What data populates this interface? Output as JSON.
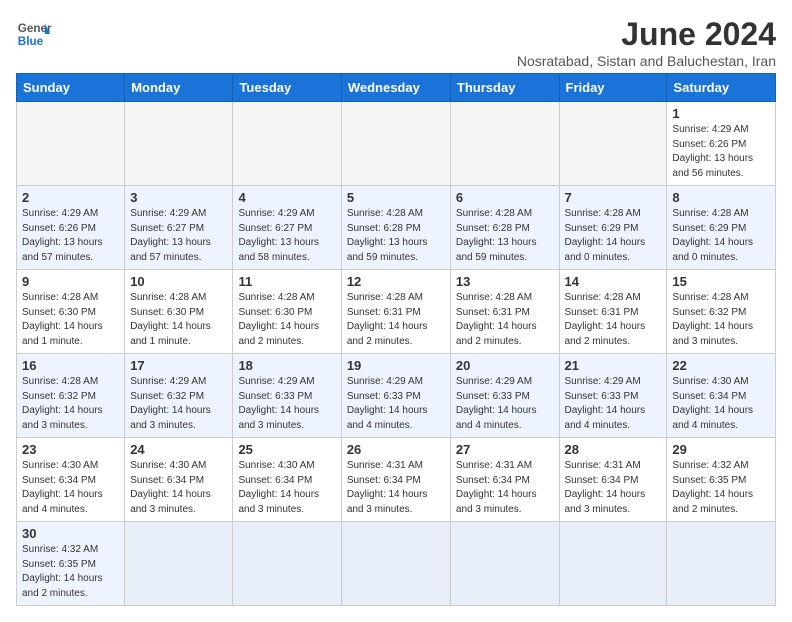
{
  "header": {
    "logo_general": "General",
    "logo_blue": "Blue",
    "month_title": "June 2024",
    "subtitle": "Nosratabad, Sistan and Baluchestan, Iran"
  },
  "weekdays": [
    "Sunday",
    "Monday",
    "Tuesday",
    "Wednesday",
    "Thursday",
    "Friday",
    "Saturday"
  ],
  "weeks": [
    [
      {
        "day": "",
        "info": ""
      },
      {
        "day": "",
        "info": ""
      },
      {
        "day": "",
        "info": ""
      },
      {
        "day": "",
        "info": ""
      },
      {
        "day": "",
        "info": ""
      },
      {
        "day": "",
        "info": ""
      },
      {
        "day": "1",
        "info": "Sunrise: 4:29 AM\nSunset: 6:26 PM\nDaylight: 13 hours\nand 56 minutes."
      }
    ],
    [
      {
        "day": "2",
        "info": "Sunrise: 4:29 AM\nSunset: 6:26 PM\nDaylight: 13 hours\nand 57 minutes."
      },
      {
        "day": "3",
        "info": "Sunrise: 4:29 AM\nSunset: 6:27 PM\nDaylight: 13 hours\nand 57 minutes."
      },
      {
        "day": "4",
        "info": "Sunrise: 4:29 AM\nSunset: 6:27 PM\nDaylight: 13 hours\nand 58 minutes."
      },
      {
        "day": "5",
        "info": "Sunrise: 4:28 AM\nSunset: 6:28 PM\nDaylight: 13 hours\nand 59 minutes."
      },
      {
        "day": "6",
        "info": "Sunrise: 4:28 AM\nSunset: 6:28 PM\nDaylight: 13 hours\nand 59 minutes."
      },
      {
        "day": "7",
        "info": "Sunrise: 4:28 AM\nSunset: 6:29 PM\nDaylight: 14 hours\nand 0 minutes."
      },
      {
        "day": "8",
        "info": "Sunrise: 4:28 AM\nSunset: 6:29 PM\nDaylight: 14 hours\nand 0 minutes."
      }
    ],
    [
      {
        "day": "9",
        "info": "Sunrise: 4:28 AM\nSunset: 6:30 PM\nDaylight: 14 hours\nand 1 minute."
      },
      {
        "day": "10",
        "info": "Sunrise: 4:28 AM\nSunset: 6:30 PM\nDaylight: 14 hours\nand 1 minute."
      },
      {
        "day": "11",
        "info": "Sunrise: 4:28 AM\nSunset: 6:30 PM\nDaylight: 14 hours\nand 2 minutes."
      },
      {
        "day": "12",
        "info": "Sunrise: 4:28 AM\nSunset: 6:31 PM\nDaylight: 14 hours\nand 2 minutes."
      },
      {
        "day": "13",
        "info": "Sunrise: 4:28 AM\nSunset: 6:31 PM\nDaylight: 14 hours\nand 2 minutes."
      },
      {
        "day": "14",
        "info": "Sunrise: 4:28 AM\nSunset: 6:31 PM\nDaylight: 14 hours\nand 2 minutes."
      },
      {
        "day": "15",
        "info": "Sunrise: 4:28 AM\nSunset: 6:32 PM\nDaylight: 14 hours\nand 3 minutes."
      }
    ],
    [
      {
        "day": "16",
        "info": "Sunrise: 4:28 AM\nSunset: 6:32 PM\nDaylight: 14 hours\nand 3 minutes."
      },
      {
        "day": "17",
        "info": "Sunrise: 4:29 AM\nSunset: 6:32 PM\nDaylight: 14 hours\nand 3 minutes."
      },
      {
        "day": "18",
        "info": "Sunrise: 4:29 AM\nSunset: 6:33 PM\nDaylight: 14 hours\nand 3 minutes."
      },
      {
        "day": "19",
        "info": "Sunrise: 4:29 AM\nSunset: 6:33 PM\nDaylight: 14 hours\nand 4 minutes."
      },
      {
        "day": "20",
        "info": "Sunrise: 4:29 AM\nSunset: 6:33 PM\nDaylight: 14 hours\nand 4 minutes."
      },
      {
        "day": "21",
        "info": "Sunrise: 4:29 AM\nSunset: 6:33 PM\nDaylight: 14 hours\nand 4 minutes."
      },
      {
        "day": "22",
        "info": "Sunrise: 4:30 AM\nSunset: 6:34 PM\nDaylight: 14 hours\nand 4 minutes."
      }
    ],
    [
      {
        "day": "23",
        "info": "Sunrise: 4:30 AM\nSunset: 6:34 PM\nDaylight: 14 hours\nand 4 minutes."
      },
      {
        "day": "24",
        "info": "Sunrise: 4:30 AM\nSunset: 6:34 PM\nDaylight: 14 hours\nand 3 minutes."
      },
      {
        "day": "25",
        "info": "Sunrise: 4:30 AM\nSunset: 6:34 PM\nDaylight: 14 hours\nand 3 minutes."
      },
      {
        "day": "26",
        "info": "Sunrise: 4:31 AM\nSunset: 6:34 PM\nDaylight: 14 hours\nand 3 minutes."
      },
      {
        "day": "27",
        "info": "Sunrise: 4:31 AM\nSunset: 6:34 PM\nDaylight: 14 hours\nand 3 minutes."
      },
      {
        "day": "28",
        "info": "Sunrise: 4:31 AM\nSunset: 6:34 PM\nDaylight: 14 hours\nand 3 minutes."
      },
      {
        "day": "29",
        "info": "Sunrise: 4:32 AM\nSunset: 6:35 PM\nDaylight: 14 hours\nand 2 minutes."
      }
    ],
    [
      {
        "day": "30",
        "info": "Sunrise: 4:32 AM\nSunset: 6:35 PM\nDaylight: 14 hours\nand 2 minutes."
      },
      {
        "day": "",
        "info": ""
      },
      {
        "day": "",
        "info": ""
      },
      {
        "day": "",
        "info": ""
      },
      {
        "day": "",
        "info": ""
      },
      {
        "day": "",
        "info": ""
      },
      {
        "day": "",
        "info": ""
      }
    ]
  ]
}
